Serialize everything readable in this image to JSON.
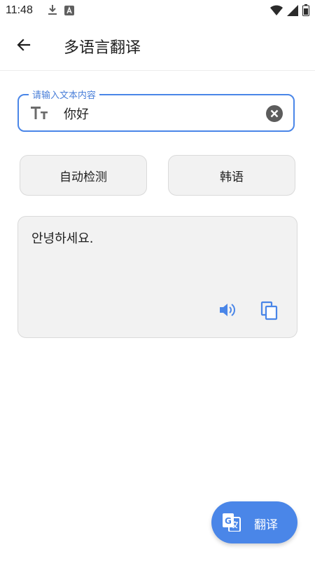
{
  "status_bar": {
    "time": "11:48",
    "left_icons": [
      "download-icon",
      "a-badge-icon"
    ],
    "right_icons": [
      "wifi-icon",
      "signal-icon",
      "battery-icon"
    ]
  },
  "app_bar": {
    "back_icon": "arrow-back-icon",
    "title": "多语言翻译"
  },
  "input": {
    "label": "请输入文本内容",
    "value": "你好",
    "leading_icon": "text-size-icon",
    "trailing_icon": "clear-icon"
  },
  "languages": {
    "source": "自动检测",
    "target": "韩语"
  },
  "output": {
    "text": "안녕하세요.",
    "actions": [
      "volume-icon",
      "copy-icon"
    ]
  },
  "fab": {
    "label": "翻译",
    "icon": "translate-icon"
  },
  "colors": {
    "accent": "#4a86e8",
    "card_bg": "#f2f2f2"
  }
}
